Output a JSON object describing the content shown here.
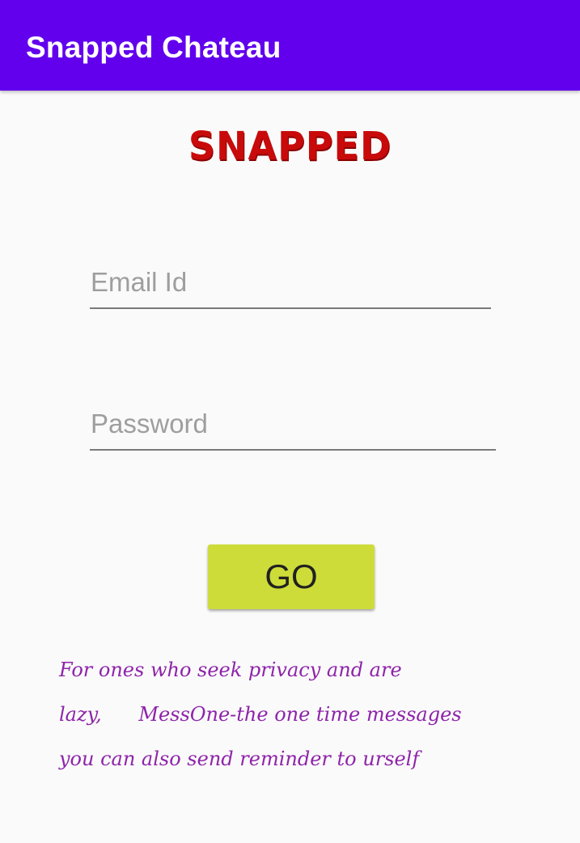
{
  "app_bar": {
    "title": "Snapped Chateau",
    "color": "#6200ee"
  },
  "logo": {
    "text": "SNAPPED",
    "color": "#c90a0a"
  },
  "login_form": {
    "email_placeholder": "Email Id",
    "email_value": "",
    "password_placeholder": "Password",
    "password_value": "",
    "go_label": "GO",
    "go_color": "#cddc39"
  },
  "tagline": {
    "lines": [
      "For ones who seek privacy and are",
      "lazy,      MessOne-the one time messages",
      "you can also send reminder to urself"
    ],
    "color": "#8e24aa"
  }
}
